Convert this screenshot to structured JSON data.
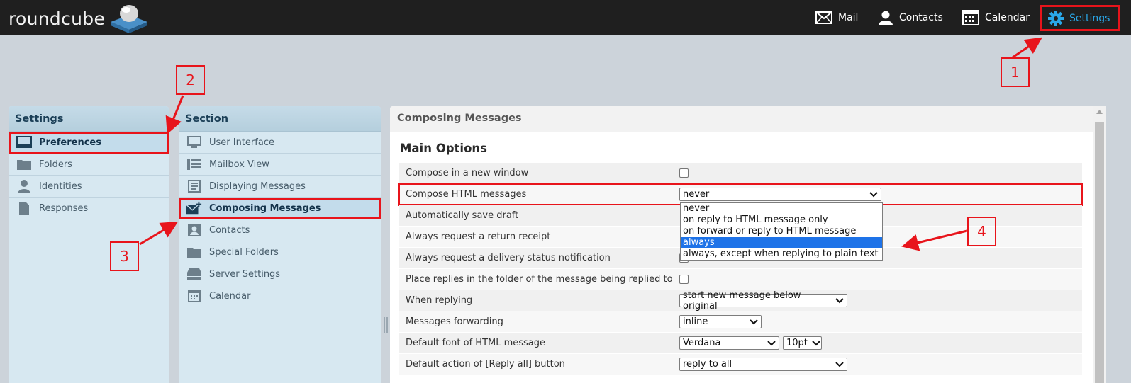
{
  "app": {
    "logo_text": "roundcube"
  },
  "topnav": {
    "mail": "Mail",
    "contacts": "Contacts",
    "calendar": "Calendar",
    "settings": "Settings"
  },
  "annotations": [
    "1",
    "2",
    "3",
    "4"
  ],
  "settings_panel": {
    "title": "Settings",
    "items": [
      {
        "label": "Preferences",
        "icon": "monitor-icon",
        "active": true
      },
      {
        "label": "Folders",
        "icon": "folder-icon",
        "active": false
      },
      {
        "label": "Identities",
        "icon": "person-icon",
        "active": false
      },
      {
        "label": "Responses",
        "icon": "document-icon",
        "active": false
      }
    ]
  },
  "section_panel": {
    "title": "Section",
    "items": [
      {
        "label": "User Interface",
        "icon": "monitor-icon",
        "active": false
      },
      {
        "label": "Mailbox View",
        "icon": "list-icon",
        "active": false
      },
      {
        "label": "Displaying Messages",
        "icon": "message-view-icon",
        "active": false
      },
      {
        "label": "Composing Messages",
        "icon": "compose-icon",
        "active": true
      },
      {
        "label": "Contacts",
        "icon": "contact-card-icon",
        "active": false
      },
      {
        "label": "Special Folders",
        "icon": "folder-icon",
        "active": false
      },
      {
        "label": "Server Settings",
        "icon": "server-icon",
        "active": false
      },
      {
        "label": "Calendar",
        "icon": "calendar-icon",
        "active": false
      }
    ]
  },
  "content": {
    "header": "Composing Messages",
    "section_title": "Main Options",
    "rows": [
      {
        "label": "Compose in a new window",
        "type": "checkbox"
      },
      {
        "label": "Compose HTML messages",
        "type": "select",
        "value": "never"
      },
      {
        "label": "Automatically save draft",
        "type": "none"
      },
      {
        "label": "Always request a return receipt",
        "type": "none"
      },
      {
        "label": "Always request a delivery status notification",
        "type": "checkbox"
      },
      {
        "label": "Place replies in the folder of the message being replied to",
        "type": "checkbox"
      },
      {
        "label": "When replying",
        "type": "select",
        "value": "start new message below original"
      },
      {
        "label": "Messages forwarding",
        "type": "select",
        "value": "inline"
      },
      {
        "label": "Default font of HTML message",
        "type": "select2",
        "value": "Verdana",
        "value2": "10pt"
      },
      {
        "label": "Default action of [Reply all] button",
        "type": "select",
        "value": "reply to all"
      }
    ],
    "html_dropdown_options": [
      {
        "label": "never",
        "selected": false
      },
      {
        "label": "on reply to HTML message only",
        "selected": false
      },
      {
        "label": "on forward or reply to HTML message",
        "selected": false
      },
      {
        "label": "always",
        "selected": true
      },
      {
        "label": "always, except when replying to plain text",
        "selected": false
      }
    ]
  },
  "colors": {
    "annotation_red": "#e8141b",
    "accent_blue": "#2aa7e8",
    "selected_blue": "#1e73e8"
  }
}
